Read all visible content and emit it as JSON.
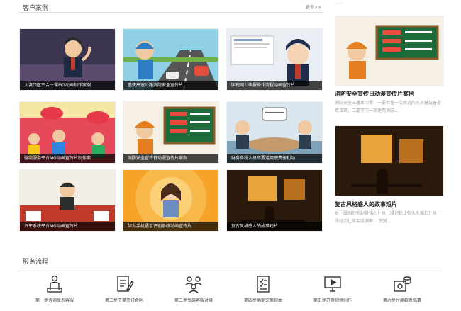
{
  "section": {
    "title": "客户案例",
    "more": "更多>>"
  },
  "top_truncated": "......",
  "cases": [
    {
      "caption": "大渡口区三合一课MG动画制作案例"
    },
    {
      "caption": "重庆高速公路消防安全宣传片"
    },
    {
      "caption": "国税网上申报操作流程动画宣传片"
    },
    {
      "caption": "微商服务平台MG动画宣传片制作案"
    },
    {
      "caption": "消防安全宣传日动漫宣传片案例"
    },
    {
      "caption": "财务各税人员不要滥用职费便利动"
    },
    {
      "caption": "汽车系统平台MG动画宣传片"
    },
    {
      "caption": "华为手机语音识别系统动画宣传片"
    },
    {
      "caption": "复古风格感人的故事短片"
    }
  ],
  "featured": [
    {
      "title": "消防安全宣传日动漫宣传片案例",
      "desc": "消防安全三基本习惯：一要检查一次就近的灭火器装备是否正常，二要学习一次使用消防..."
    },
    {
      "title": "复古风格感人的故事短片",
      "desc": "总一段回忆你刻骨铭心！总一段记忆让你久久难忘！总一段经历让你泪流满面！ 究就..."
    }
  ],
  "process": {
    "title": "服务流程",
    "steps": [
      {
        "label": "第一步咨询联系客服",
        "icon": "person-podium-icon"
      },
      {
        "label": "第二步下单签订合同",
        "icon": "contract-pen-icon"
      },
      {
        "label": "第三步专属客服对接",
        "icon": "team-connect-icon"
      },
      {
        "label": "第四步确定文案脚本",
        "icon": "checklist-icon"
      },
      {
        "label": "第五步开票视频创作",
        "icon": "monitor-video-icon"
      },
      {
        "label": "第六步付尾款发高清",
        "icon": "coin-payment-icon"
      }
    ]
  },
  "colors": {
    "accent": "#e53e3e",
    "caption_bg": "#000000"
  }
}
